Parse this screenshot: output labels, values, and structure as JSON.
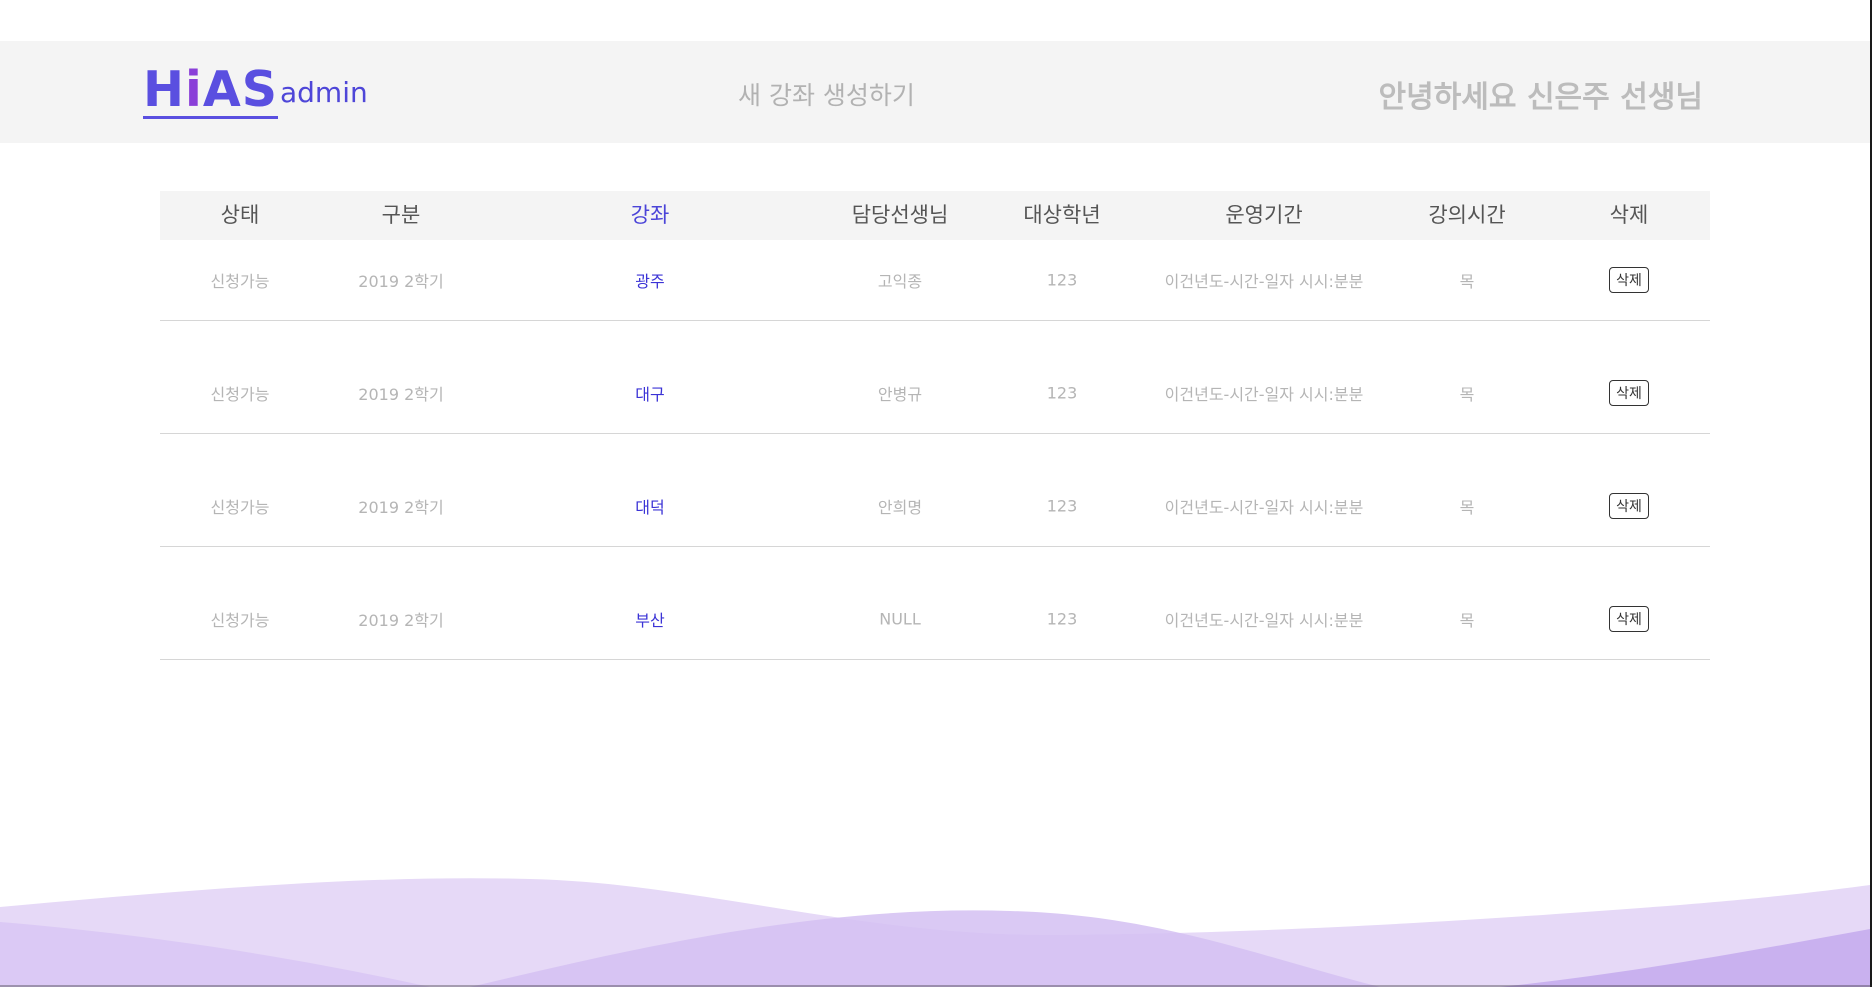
{
  "header": {
    "logo": {
      "h": "H",
      "i": "i",
      "as": "AS"
    },
    "role": "admin",
    "new_course_link": "새 강좌 생성하기",
    "greeting": "안녕하세요 신은주 선생님"
  },
  "table": {
    "columns": [
      "상태",
      "구분",
      "강좌",
      "담당선생님",
      "대상학년",
      "운영기간",
      "강의시간",
      "삭제"
    ],
    "rows": [
      {
        "status": "신청가능",
        "term": "2019 2학기",
        "course": "광주",
        "teacher": "고익종",
        "grade": "123",
        "period": "이건년도-시간-일자 시시:분분",
        "time": "목",
        "delete_label": "삭제"
      },
      {
        "status": "신청가능",
        "term": "2019 2학기",
        "course": "대구",
        "teacher": "안병규",
        "grade": "123",
        "period": "이건년도-시간-일자 시시:분분",
        "time": "목",
        "delete_label": "삭제"
      },
      {
        "status": "신청가능",
        "term": "2019 2학기",
        "course": "대덕",
        "teacher": "안희명",
        "grade": "123",
        "period": "이건년도-시간-일자 시시:분분",
        "time": "목",
        "delete_label": "삭제"
      },
      {
        "status": "신청가능",
        "term": "2019 2학기",
        "course": "부산",
        "teacher": "NULL",
        "grade": "123",
        "period": "이건년도-시간-일자 시시:분분",
        "time": "목",
        "delete_label": "삭제"
      }
    ]
  },
  "colors": {
    "accent": "#4b44d8",
    "logo_i": "#8a3fd8",
    "header_bg": "#f4f4f4",
    "muted_text": "#b5b5b5",
    "wave_light": "#e6d9f7",
    "wave_dark": "#c9b1ef"
  }
}
